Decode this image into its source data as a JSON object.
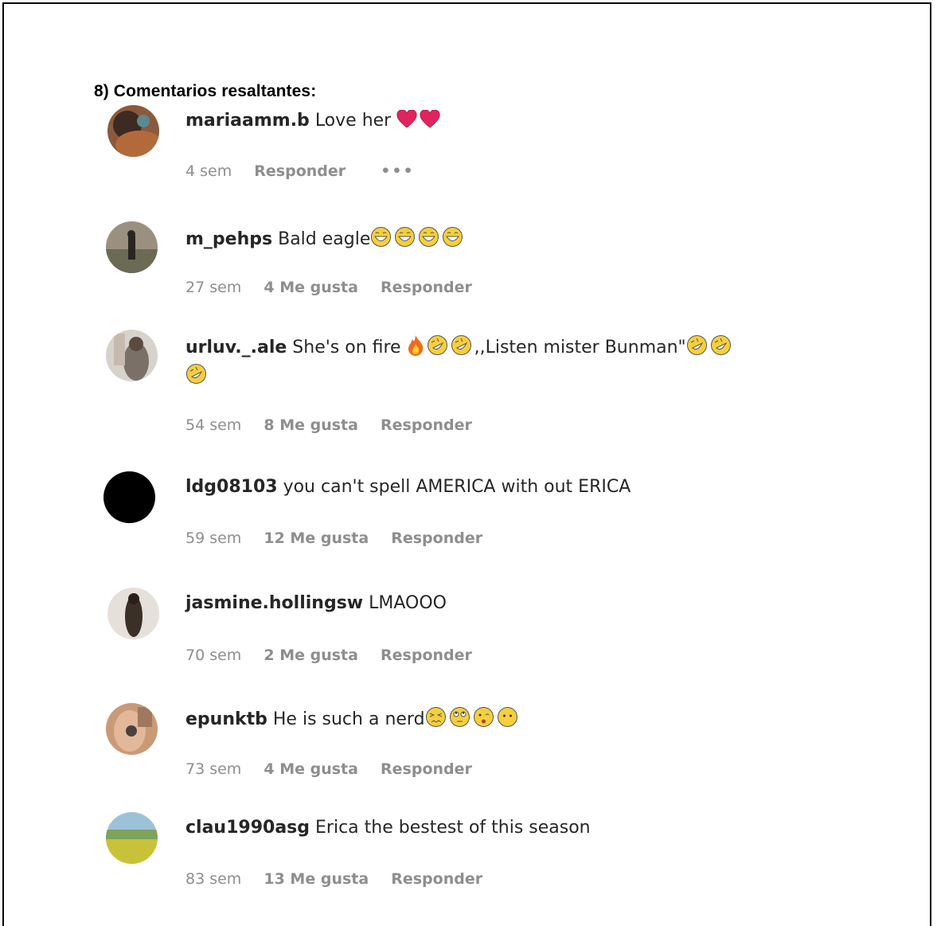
{
  "heading": "8) Comentarios resaltantes:",
  "comments": [
    {
      "user": "mariaamm.b",
      "text": "Love her",
      "time": "4 sem",
      "likes": "",
      "reply": "Responder",
      "more": "•••"
    },
    {
      "user": "m_pehps",
      "text": "Bald eagle",
      "time": "27 sem",
      "likes": "4 Me gusta",
      "reply": "Responder"
    },
    {
      "user": "urluv._.ale",
      "text": "She's on fire",
      "text2": ",,Listen mister Bunman\"",
      "time": "54 sem",
      "likes": "8 Me gusta",
      "reply": "Responder"
    },
    {
      "user": "ldg08103",
      "text": "you can't spell AMERICA with out ERICA",
      "time": "59 sem",
      "likes": "12 Me gusta",
      "reply": "Responder"
    },
    {
      "user": "jasmine.hollingsw",
      "text": "LMAOOO",
      "time": "70 sem",
      "likes": "2 Me gusta",
      "reply": "Responder"
    },
    {
      "user": "epunktb",
      "text": "He is such a nerd",
      "time": "73 sem",
      "likes": "4 Me gusta",
      "reply": "Responder"
    },
    {
      "user": "clau1990asg",
      "text": "Erica the bestest of this season",
      "time": "83 sem",
      "likes": "13 Me gusta",
      "reply": "Responder"
    }
  ]
}
